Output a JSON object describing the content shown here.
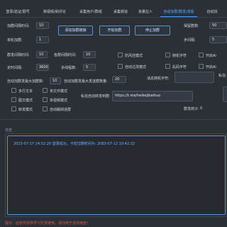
{
  "tabs": [
    {
      "label": "登录/验证/弱号"
    },
    {
      "label": "刷视频/刷评论"
    },
    {
      "label": "采集用户/群组"
    },
    {
      "label": "采集频道"
    },
    {
      "label": "批量拉人"
    },
    {
      "label": "自动加群/群发/观看"
    },
    {
      "label": "自动找"
    }
  ],
  "active_tab_index": 5,
  "settings": {
    "join_interval_label": "加群间隔时间:",
    "join_interval_value": "10",
    "per_account_join_label": "单轮加群:",
    "per_account_join_value": "1",
    "buttons": {
      "import_groups": "添加加群链接",
      "start_join": "开始加群",
      "stop_join": "停止加群"
    },
    "keep_group_label": "保留群数:",
    "keep_group_value": "50",
    "loop_count_label": "步间隔:",
    "loop_count_value": "5",
    "send_interval_label": "群发间隔时间:",
    "send_interval_value": "10",
    "each_group_interval_label": "各群间隔时间:",
    "each_group_interval_value": "10",
    "scheduled_label": "定时间隔:",
    "scheduled_value": "3600",
    "multi_thread_label": "多线程数:",
    "multi_thread_value": "5",
    "max_join_label": "自动加群发最大加群数:",
    "max_join_value": "10",
    "max_send_label": "自动加群发最大发送群数量:",
    "max_send_value": "20",
    "filter_label": "消息随机字符:",
    "filter_value": "",
    "private_label": "私信:",
    "link_label": "私信自动转发到群:",
    "link_value": "https://t.me/heikejibaihuo",
    "stats_label": "群发统计:",
    "stats_value": "0"
  },
  "options_right": [
    {
      "label": "防风控模式"
    },
    {
      "label": "随机字符"
    },
    {
      "label": "开启Ai"
    },
    {
      "label": "自动过改模式"
    },
    {
      "label": "乱码字符"
    },
    {
      "label": "开启Ai"
    }
  ],
  "options_left": [
    {
      "label": "多行文本"
    },
    {
      "label": "图文模式"
    },
    {
      "label": "转发模式"
    }
  ],
  "options_mid": [
    {
      "label": "单文件模式"
    },
    {
      "label": "单视频模式"
    },
    {
      "label": "自动踢掉进群"
    }
  ],
  "log": {
    "title": "日志",
    "lines": [
      "2023-07-17 14:52:20 登录成功，卡密过期时间为: 2083-07-12 10:42:32"
    ]
  },
  "footer_text": "提示：此软件仅供学习交流使用，请勿用于违法用途！"
}
